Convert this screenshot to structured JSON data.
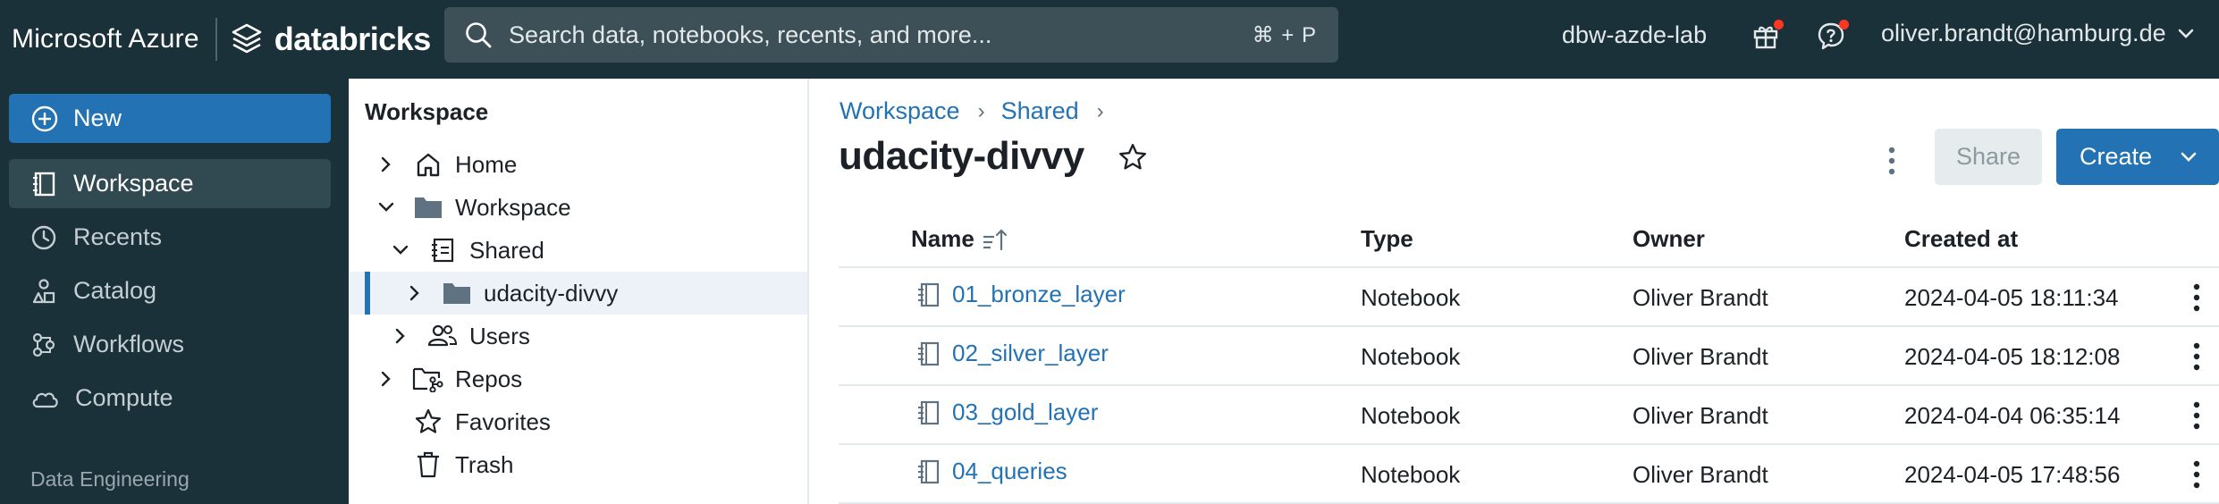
{
  "topbar": {
    "cloud_name": "Microsoft Azure",
    "product_name": "databricks",
    "search_placeholder": "Search data, notebooks, recents, and more...",
    "search_shortcut": "⌘ + P",
    "workspace_name": "dbw-azde-lab",
    "user_email": "oliver.brandt@hamburg.de"
  },
  "sidebar": {
    "new_label": "New",
    "items": [
      {
        "label": "Workspace",
        "icon": "workspace-icon",
        "active": true
      },
      {
        "label": "Recents",
        "icon": "clock-icon"
      },
      {
        "label": "Catalog",
        "icon": "catalog-icon"
      },
      {
        "label": "Workflows",
        "icon": "workflows-icon"
      },
      {
        "label": "Compute",
        "icon": "cloud-icon"
      }
    ],
    "section_label": "Data Engineering"
  },
  "tree": {
    "title": "Workspace",
    "items": [
      {
        "label": "Home",
        "icon": "home-icon",
        "expanded": false
      },
      {
        "label": "Workspace",
        "icon": "folder-icon",
        "expanded": true
      },
      {
        "label": "Shared",
        "icon": "shared-folder-icon",
        "expanded": true
      },
      {
        "label": "udacity-divvy",
        "icon": "folder-icon",
        "expanded": false,
        "selected": true
      },
      {
        "label": "Users",
        "icon": "users-icon",
        "expanded": false
      },
      {
        "label": "Repos",
        "icon": "repos-icon",
        "expanded": false
      },
      {
        "label": "Favorites",
        "icon": "star-icon"
      },
      {
        "label": "Trash",
        "icon": "trash-icon"
      }
    ]
  },
  "main": {
    "breadcrumb": [
      "Workspace",
      "Shared"
    ],
    "title": "udacity-divvy",
    "share_label": "Share",
    "create_label": "Create",
    "table": {
      "columns": [
        "Name",
        "Type",
        "Owner",
        "Created at"
      ],
      "rows": [
        {
          "name": "01_bronze_layer",
          "type": "Notebook",
          "owner": "Oliver Brandt",
          "created": "2024-04-05 18:11:34"
        },
        {
          "name": "02_silver_layer",
          "type": "Notebook",
          "owner": "Oliver Brandt",
          "created": "2024-04-05 18:12:08"
        },
        {
          "name": "03_gold_layer",
          "type": "Notebook",
          "owner": "Oliver Brandt",
          "created": "2024-04-04 06:35:14"
        },
        {
          "name": "04_queries",
          "type": "Notebook",
          "owner": "Oliver Brandt",
          "created": "2024-04-05 17:48:56"
        }
      ]
    }
  },
  "colors": {
    "nav_bg": "#1b3139",
    "accent": "#2272b4",
    "notification": "#ff3621"
  }
}
